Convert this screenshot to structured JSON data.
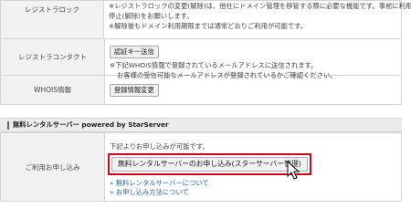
{
  "registrar_lock": {
    "label": "レジストラロック",
    "desc1": "※レジストラロックの変更(解除)は、他社にドメイン管理を移管する際に必要な機能です。事前に利用",
    "desc2": "停止(解除)をお願いします。",
    "desc3": "※解除後もドメイン利用期限までは通常どおりご利用が可能です。"
  },
  "registrar_contact": {
    "label": "レジストラコンタクト",
    "button": "認証キー送信",
    "desc1": "※下記WHOIS情報で登録されているメールアドレスに送信されます。",
    "desc2": "お客様の受信可能なメールアドレスが登録されているかご確認ください。"
  },
  "whois": {
    "label": "WHOIS情報",
    "button": "登録情報変更"
  },
  "free_server_section": {
    "title": "無料レンタルサーバー powered by StarServer"
  },
  "application": {
    "label": "ご利用お申し込み",
    "intro": "下記よりお申し込みが可能です。",
    "button": "無料レンタルサーバーのお申し込み(スターサーバー管理)",
    "links": [
      "» 無料レンタルサーバーについて",
      "» お申し込み方法について"
    ]
  },
  "colors": {
    "highlight": "#e0001b",
    "link": "#1a64b8"
  }
}
